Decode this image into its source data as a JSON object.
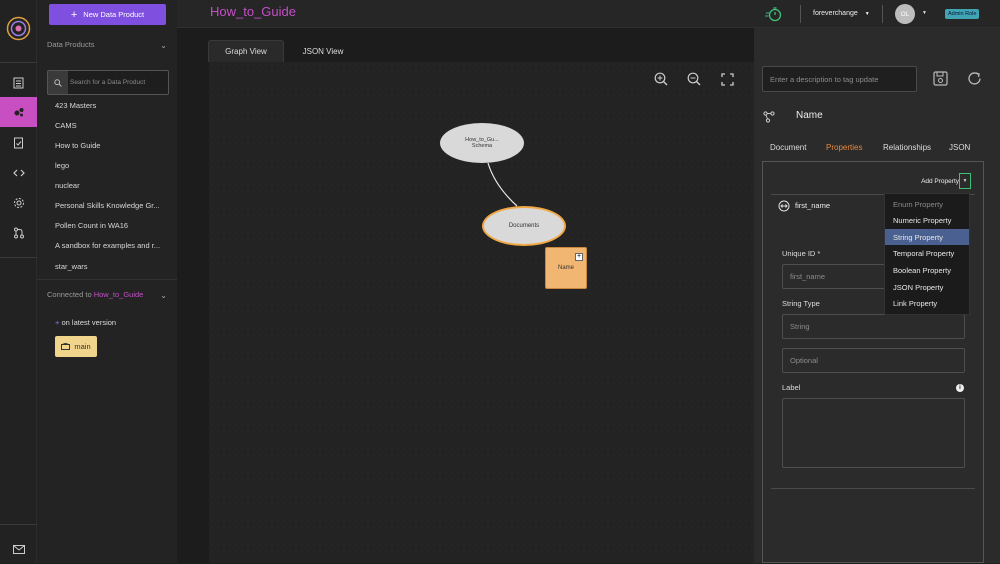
{
  "header": {
    "page_title": "How_to_Guide",
    "org_name": "foreverchange",
    "avatar_initials": "OL",
    "role_badge": "Admin Role"
  },
  "sidebar": {
    "new_button_label": "New Data Product",
    "section_title": "Data Products",
    "search_placeholder": "Search for a Data Product",
    "items": [
      "423 Masters",
      "CAMS",
      "How to Guide",
      "lego",
      "nuclear",
      "Personal Skills Knowledge Gr...",
      "Pollen Count in WA16",
      "A sandbox for examples and r...",
      "star_wars"
    ],
    "connected_prefix": "Connected to",
    "connected_name": "How_to_Guide",
    "version_status": "on latest version",
    "branch_name": "main"
  },
  "canvas": {
    "tabs": [
      "Graph View",
      "JSON View"
    ],
    "active_tab": "Graph View",
    "nodes": {
      "schema_line1": "How_to_Gu...",
      "schema_line2": "Schema",
      "documents": "Documents",
      "name": "Name"
    }
  },
  "panel": {
    "description_placeholder": "Enter a description to tag update",
    "title": "Name",
    "tabs": [
      "Document",
      "Properties",
      "Relationships",
      "JSON"
    ],
    "active_tab": "Properties",
    "add_property_label": "Add Property",
    "property_name": "first_name",
    "unique_id_label": "Unique ID *",
    "unique_id_placeholder": "first_name",
    "string_type_label": "String Type",
    "string_type_placeholder": "String",
    "optional_placeholder": "Optional",
    "label_label": "Label"
  },
  "dropdown": {
    "items": [
      {
        "label": "Enum Property",
        "state": "disabled"
      },
      {
        "label": "Numeric Property",
        "state": "normal"
      },
      {
        "label": "String Property",
        "state": "selected"
      },
      {
        "label": "Temporal Property",
        "state": "normal"
      },
      {
        "label": "Boolean Property",
        "state": "normal"
      },
      {
        "label": "JSON Property",
        "state": "normal"
      },
      {
        "label": "Link Property",
        "state": "normal"
      }
    ]
  },
  "colors": {
    "accent_purple": "#7f4fe0",
    "title_pink": "#c44fc8",
    "active_orange": "#e8883d",
    "branch_yellow": "#f2d58c",
    "selected_blue": "#4a6090"
  }
}
